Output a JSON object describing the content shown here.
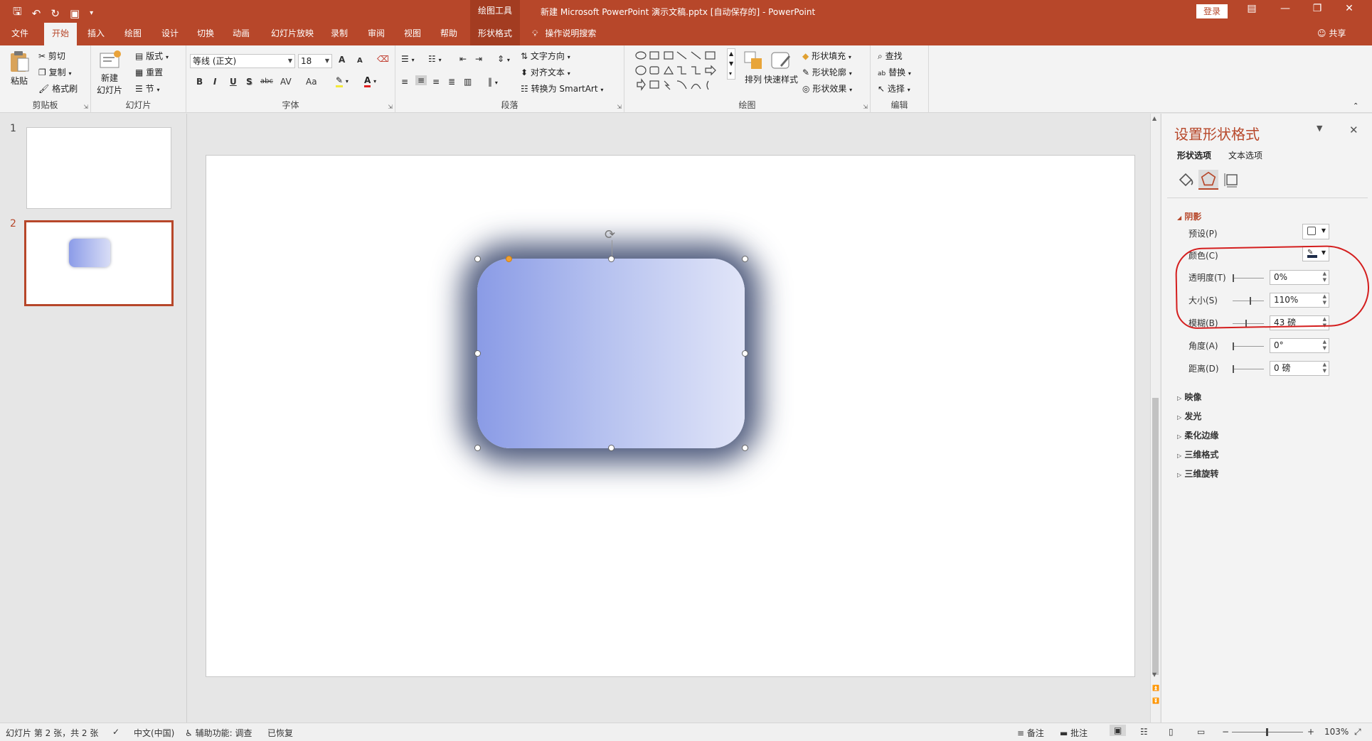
{
  "colors": {
    "accent": "#b7472a",
    "annotation": "#d41e1e",
    "shape_gradient_start": "#8a9be6",
    "shape_gradient_end": "#e1e5f8",
    "shadow": "#303e66"
  },
  "titlebar": {
    "context_tools": "绘图工具",
    "doc_title": "新建 Microsoft PowerPoint 演示文稿.pptx [自动保存的]  -  PowerPoint",
    "login": "登录",
    "qat_icons": [
      "save-icon",
      "undo-icon",
      "redo-icon",
      "present-icon",
      "customize-icon"
    ],
    "window_icons": [
      "ribbon-display-icon",
      "minimize-icon",
      "restore-icon",
      "close-icon"
    ]
  },
  "tabs": {
    "items": [
      "文件",
      "开始",
      "插入",
      "绘图",
      "设计",
      "切换",
      "动画",
      "幻灯片放映",
      "录制",
      "审阅",
      "视图",
      "帮助"
    ],
    "active": "开始",
    "context_tab": "形状格式",
    "tell_me": "操作说明搜索",
    "share": "共享"
  },
  "ribbon": {
    "clipboard": {
      "label": "剪贴板",
      "paste": "粘贴",
      "cut": "剪切",
      "copy": "复制",
      "format_painter": "格式刷"
    },
    "slides": {
      "label": "幻灯片",
      "new_slide_1": "新建",
      "new_slide_2": "幻灯片",
      "layout": "版式",
      "reset": "重置",
      "section": "节"
    },
    "font": {
      "label": "字体",
      "font_name": "等线 (正文)",
      "font_size": "18",
      "bold": "B",
      "italic": "I",
      "underline": "U",
      "shadow": "S",
      "strike": "abc",
      "spacing": "AV",
      "case": "Aa",
      "grow": "A",
      "shrink": "A"
    },
    "paragraph": {
      "label": "段落",
      "text_direction": "文字方向",
      "align_text": "对齐文本",
      "smartart": "转换为 SmartArt"
    },
    "drawing": {
      "label": "绘图",
      "arrange": "排列",
      "quick_styles": "快速样式",
      "fill": "形状填充",
      "outline": "形状轮廓",
      "effects": "形状效果"
    },
    "editing": {
      "label": "编辑",
      "find": "查找",
      "replace": "替换",
      "select": "选择"
    }
  },
  "thumbnails": {
    "slide_numbers": [
      "1",
      "2"
    ],
    "selected": 2
  },
  "format_pane": {
    "title": "设置形状格式",
    "tab_shape": "形状选项",
    "tab_text": "文本选项",
    "section_shadow": "阴影",
    "preset_label": "预设(P)",
    "color_label": "颜色(C)",
    "transparency_label": "透明度(T)",
    "transparency_value": "0%",
    "size_label": "大小(S)",
    "size_value": "110%",
    "blur_label": "模糊(B)",
    "blur_value": "43 磅",
    "angle_label": "角度(A)",
    "angle_value": "0°",
    "distance_label": "距离(D)",
    "distance_value": "0 磅",
    "collapsed_sections": [
      "映像",
      "发光",
      "柔化边缘",
      "三维格式",
      "三维旋转"
    ]
  },
  "status": {
    "slide_info": "幻灯片 第 2 张，共 2 张",
    "language": "中文(中国)",
    "accessibility": "辅助功能: 调查",
    "recovered": "已恢复",
    "notes": "备注",
    "comments": "批注",
    "zoom": "103%"
  }
}
